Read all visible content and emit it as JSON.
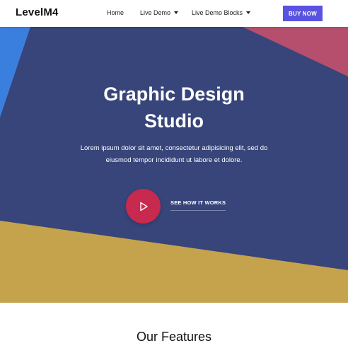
{
  "navbar": {
    "brand": "LevelM4",
    "items": [
      {
        "label": "Home"
      },
      {
        "label": "Live Demo"
      },
      {
        "label": "Live Demo Blocks"
      }
    ],
    "buy_label": "BUY NOW"
  },
  "hero": {
    "title_line1": "Graphic Design",
    "title_line2": "Studio",
    "subtitle": "Lorem ipsum dolor sit amet, consectetur adipisicing elit, sed do eiusmod tempor incididunt ut labore et dolore.",
    "cta_label": "SEE HOW IT WORKS"
  },
  "features": {
    "title": "Our Features"
  },
  "colors": {
    "navy": "#37457a",
    "blue": "#3b7fde",
    "pink": "#b64f6d",
    "gold": "#c5a34d",
    "play_red": "#c7294f",
    "buy_purple": "#5a52e0"
  },
  "icons": {
    "play": "play-icon",
    "dropdown": "caret-down-icon"
  }
}
